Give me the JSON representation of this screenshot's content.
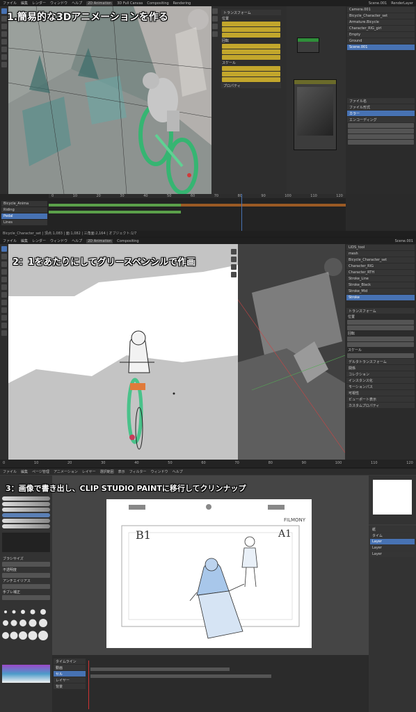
{
  "captions": {
    "step1": "1.簡易的な3Dアニメーションを作る",
    "step2": "2：1をあたりにしてグリースペンシルで作画",
    "step3": "3：画像で書き出し、CLIP STUDIO PAINTに移行してクリンナップ"
  },
  "blender": {
    "menu": [
      "ファイル",
      "編集",
      "レンダー",
      "ウィンドウ",
      "ヘルプ",
      "2D Animation",
      "3D Full Canvas",
      "Compositing",
      "Rendering"
    ],
    "scene_name": "Scene.001",
    "view_layer": "RenderLayer",
    "outliner_items": [
      "Camera.001",
      "Bicycle_Character_set",
      "Armature.Bicycle",
      "Character_RIG_girl",
      "Empty",
      "Ground"
    ],
    "outliner_items2": [
      "LIDS_tool",
      "mesh",
      "Bicycle_Character_set",
      "Character_RIG",
      "Character_RTH",
      "Stroke_Line",
      "Stroke_Black",
      "Stroke_Mid",
      "Stroke_Fill",
      "Stroke"
    ],
    "props1": [
      "ファイル名",
      "ファイル形式",
      "カラー",
      "エンコーディング"
    ],
    "props2": [
      "トランスフォーム",
      "位置",
      "回転",
      "スケール",
      "デルタトランスフォーム",
      "関係",
      "コレクション",
      "インスタンス化",
      "モーションパス",
      "可視性",
      "ビューポート表示",
      "カスタムプロパティ"
    ],
    "tracks": [
      "Bicycle_Anima",
      "Riding",
      "Pedal",
      "Lines",
      "Colors"
    ],
    "panel_labels": {
      "transform": "トランスフォーム",
      "location": "位置",
      "rotation": "回転",
      "scale": "スケール",
      "properties": "プロパティ",
      "layers": "レイヤー"
    },
    "timeline_ticks": [
      "0",
      "10",
      "20",
      "30",
      "40",
      "50",
      "60",
      "70",
      "80",
      "90",
      "100",
      "110",
      "120"
    ],
    "status1": "Bicycle_Character_set | 頂点:1,083 | 面:1,082 | 三角面:2,164 | オブジェクト:1/7",
    "frame": "1"
  },
  "csp": {
    "menu": [
      "ファイル",
      "編集",
      "ページ管理",
      "アニメーション",
      "レイヤー",
      "選択範囲",
      "表示",
      "フィルター",
      "ウィンドウ",
      "ヘルプ"
    ],
    "sheet_labels": {
      "left": "B1",
      "right": "A1",
      "brand": "FILMONY"
    },
    "tool_labels": [
      "ブラシサイズ",
      "不透明度",
      "アンチエイリアス",
      "手ブレ補正"
    ],
    "layers": [
      "紙",
      "タイム",
      "Layer",
      "Layer",
      "Layer"
    ],
    "track_names": [
      "タイムライン",
      "動画",
      "セル",
      "レイヤー",
      "背景"
    ]
  }
}
